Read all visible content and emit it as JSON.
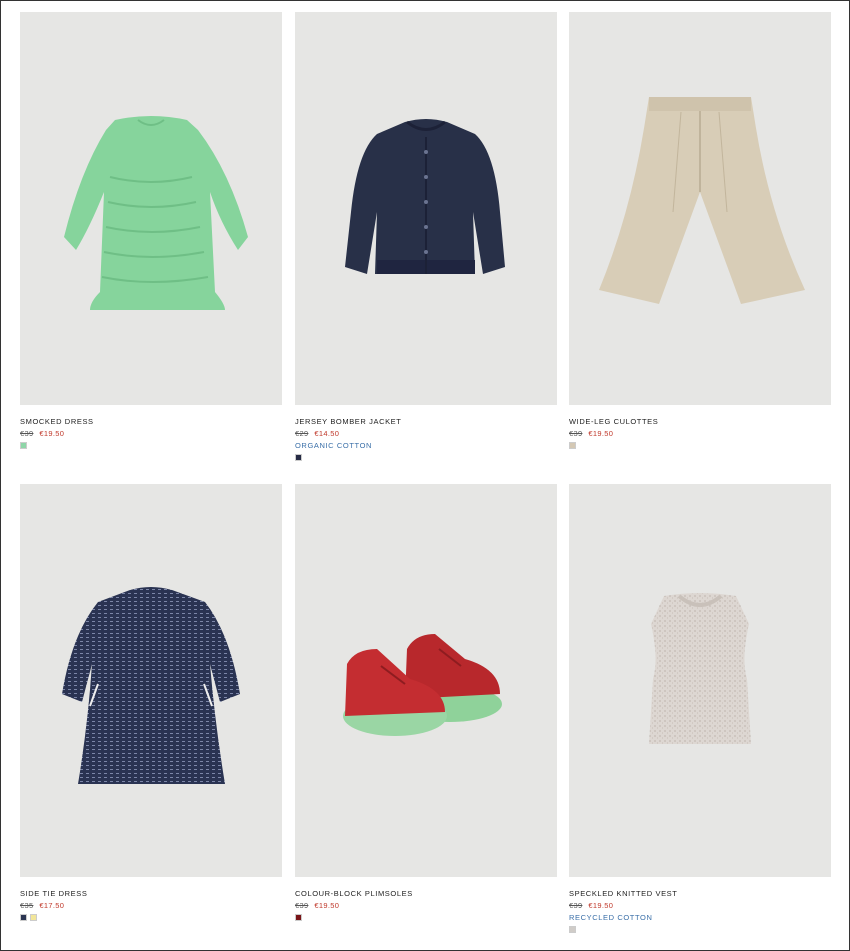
{
  "products": [
    {
      "name": "SMOCKED DRESS",
      "old_price": "€39",
      "new_price": "€19.50",
      "tag": "",
      "swatches": [
        "#8fd6a8"
      ],
      "image": "green-smocked-dress"
    },
    {
      "name": "JERSEY BOMBER JACKET",
      "old_price": "€29",
      "new_price": "€14.50",
      "tag": "ORGANIC COTTON",
      "swatches": [
        "#262b45"
      ],
      "image": "navy-bomber-jacket"
    },
    {
      "name": "WIDE-LEG CULOTTES",
      "old_price": "€39",
      "new_price": "€19.50",
      "tag": "",
      "swatches": [
        "#d4c8b4"
      ],
      "image": "beige-culottes"
    },
    {
      "name": "SIDE TIE DRESS",
      "old_price": "€35",
      "new_price": "€17.50",
      "tag": "",
      "swatches": [
        "#2b3552",
        "#f2e69a"
      ],
      "image": "navy-tweed-dress"
    },
    {
      "name": "COLOUR-BLOCK PLIMSOLES",
      "old_price": "€39",
      "new_price": "€19.50",
      "tag": "",
      "swatches": [
        "#7a1418"
      ],
      "image": "red-green-plimsoles"
    },
    {
      "name": "SPECKLED KNITTED VEST",
      "old_price": "€39",
      "new_price": "€19.50",
      "tag": "RECYCLED COTTON",
      "swatches": [
        "#d0ccc8"
      ],
      "image": "speckled-knit-vest"
    }
  ]
}
